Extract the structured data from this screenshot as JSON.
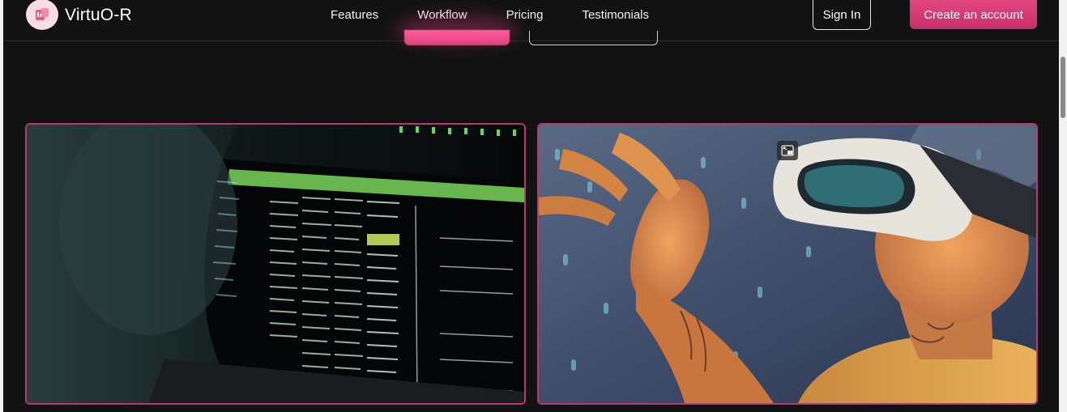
{
  "brand": {
    "name": "VirtuO-R",
    "logo_icon": "vr-headset-logo-icon"
  },
  "nav": {
    "links": [
      {
        "label": "Features"
      },
      {
        "label": "Workflow"
      },
      {
        "label": "Pricing"
      },
      {
        "label": "Testimonials"
      }
    ]
  },
  "auth": {
    "signin_label": "Sign In",
    "create_label": "Create an account"
  },
  "media": {
    "cards": [
      {
        "subject": "terminal-screen-image"
      },
      {
        "subject": "vr-headset-person-image",
        "overlay_icon": "picture-in-picture-icon"
      }
    ]
  },
  "colors": {
    "accent": "#e2467f",
    "card_border": "#b53b6c",
    "background": "#121212"
  }
}
